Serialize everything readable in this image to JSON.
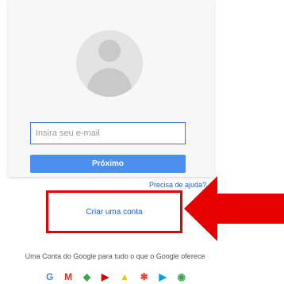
{
  "form": {
    "email_placeholder": "Insira seu e-mail",
    "next_label": "Próximo",
    "help_link": "Precisa de ajuda?"
  },
  "create_account": {
    "label": "Criar uma conta"
  },
  "footer": {
    "tagline": "Uma Conta do Google para tudo o que o Google oferece",
    "products": [
      {
        "icon": "google-g-icon",
        "glyph": "G",
        "color": "#4285f4"
      },
      {
        "icon": "gmail-icon",
        "glyph": "M",
        "color": "#d93025"
      },
      {
        "icon": "maps-icon",
        "glyph": "◆",
        "color": "#34a853"
      },
      {
        "icon": "youtube-icon",
        "glyph": "▶",
        "color": "#cc0000"
      },
      {
        "icon": "drive-icon",
        "glyph": "▲",
        "color": "#fbbc05"
      },
      {
        "icon": "photos-icon",
        "glyph": "✱",
        "color": "#ea4335"
      },
      {
        "icon": "play-store-icon",
        "glyph": "▶",
        "color": "#00a0e3"
      },
      {
        "icon": "chrome-icon",
        "glyph": "◉",
        "color": "#34a853"
      }
    ]
  },
  "colors": {
    "accent": "#4d8ff0",
    "link": "#1a5fd3",
    "highlight": "#e60000"
  }
}
